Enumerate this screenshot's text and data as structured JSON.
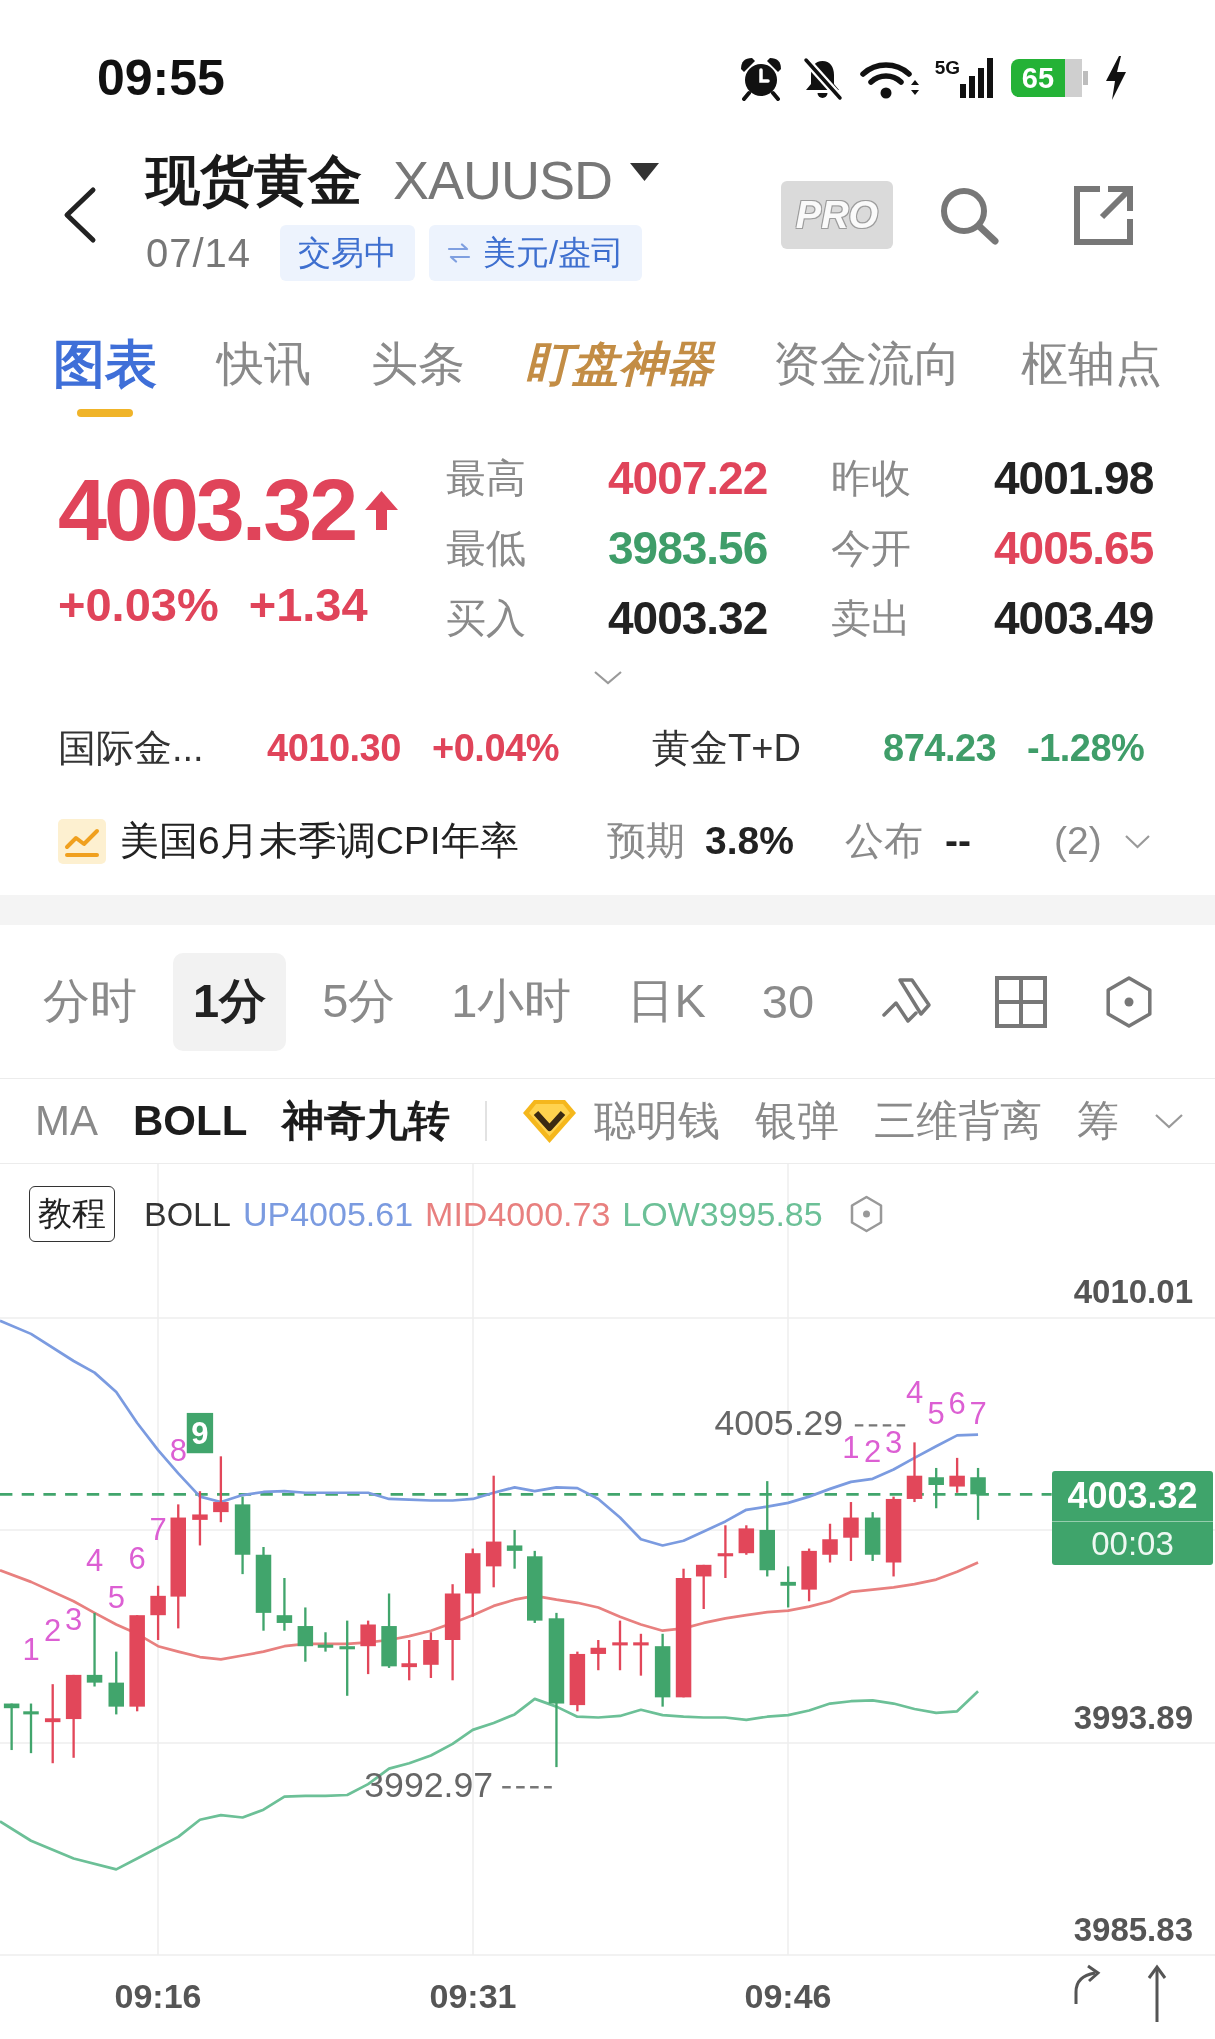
{
  "status_bar": {
    "time": "09:55",
    "network": "5G",
    "battery": "65"
  },
  "header": {
    "title": "现货黄金",
    "symbol": "XAUUSD",
    "date": "07/14",
    "badges": [
      {
        "kind": "status",
        "label": "交易中"
      },
      {
        "kind": "unit",
        "label": "美元/盎司"
      }
    ],
    "pro": "PRO"
  },
  "tabs": [
    {
      "label": "图表",
      "kind": "plain",
      "selected": true
    },
    {
      "label": "快讯",
      "kind": "plain",
      "selected": false
    },
    {
      "label": "头条",
      "kind": "plain",
      "selected": false
    },
    {
      "label": "盯盘神器",
      "kind": "featured",
      "selected": false
    },
    {
      "label": "资金流向",
      "kind": "plain",
      "selected": false
    },
    {
      "label": "枢轴点",
      "kind": "plain",
      "selected": false
    }
  ],
  "quote": {
    "price": "4003.32",
    "color": "#e0445a",
    "rising": true,
    "change_percent": "+0.03%",
    "change": "+1.34",
    "stats": [
      {
        "label": "最高",
        "value": "4007.22",
        "color": "#e0445a"
      },
      {
        "label": "昨收",
        "value": "4001.98",
        "color": "#222222"
      },
      {
        "label": "最低",
        "value": "3983.56",
        "color": "#3f9d69"
      },
      {
        "label": "今开",
        "value": "4005.65",
        "color": "#e0445a"
      },
      {
        "label": "买入",
        "value": "4003.32",
        "color": "#222222"
      },
      {
        "label": "卖出",
        "value": "4003.49",
        "color": "#222222"
      }
    ]
  },
  "related": [
    {
      "name": "国际金...",
      "price": "4010.30",
      "change": "+0.04%",
      "color": "#e0445a"
    },
    {
      "name": "黄金T+D",
      "price": "874.23",
      "change": "-1.28%",
      "color": "#3f9d69"
    }
  ],
  "event": {
    "title": "美国6月未季调CPI年率",
    "forecast_label": "预期",
    "forecast": "3.8%",
    "actual_label": "公布",
    "actual": "--",
    "count": "(2)"
  },
  "periods": [
    {
      "label": "分时",
      "selected": false
    },
    {
      "label": "1分",
      "selected": true
    },
    {
      "label": "5分",
      "selected": false
    },
    {
      "label": "1小时",
      "selected": false
    },
    {
      "label": "日K",
      "selected": false
    },
    {
      "label": "30",
      "selected": false
    }
  ],
  "indicators": {
    "main": [
      {
        "label": "MA",
        "selected": false
      },
      {
        "label": "BOLL",
        "selected": true
      },
      {
        "label": "神奇九转",
        "selected": true
      }
    ],
    "features": [
      {
        "label": "聪明钱",
        "premium": true,
        "selected": false
      },
      {
        "label": "银弹",
        "premium": false,
        "selected": false
      },
      {
        "label": "三维背离",
        "premium": false,
        "selected": false
      },
      {
        "label": "筹",
        "premium": false,
        "selected": false
      }
    ]
  },
  "chart": {
    "tutorial": "教程",
    "indicator": "BOLL",
    "bands": [
      {
        "label": "UP4005.61",
        "color": "#7b9be0"
      },
      {
        "label": "MID4000.73",
        "color": "#e8807f"
      },
      {
        "label": "LOW3995.85",
        "color": "#6cc097"
      }
    ],
    "y_labels": [
      "4010.01",
      "3993.89",
      "3985.83"
    ],
    "x_labels": [
      "09:16",
      "09:31",
      "09:46"
    ],
    "high_marker": "4005.29",
    "low_marker": "3992.97",
    "current_price": "4003.32",
    "countdown": "00:03",
    "sequence_marks": [
      {
        "text": "1",
        "kind": "count"
      },
      {
        "text": "2",
        "kind": "count"
      },
      {
        "text": "3",
        "kind": "count"
      },
      {
        "text": "4",
        "kind": "count"
      },
      {
        "text": "5",
        "kind": "count"
      },
      {
        "text": "6",
        "kind": "count"
      },
      {
        "text": "7",
        "kind": "count"
      },
      {
        "text": "8",
        "kind": "count"
      },
      {
        "text": "9",
        "kind": "signal"
      },
      {
        "text": "1",
        "kind": "count"
      },
      {
        "text": "2",
        "kind": "count"
      },
      {
        "text": "3",
        "kind": "count"
      },
      {
        "text": "4",
        "kind": "count"
      },
      {
        "text": "5",
        "kind": "count"
      },
      {
        "text": "6",
        "kind": "count"
      },
      {
        "text": "7",
        "kind": "count"
      }
    ]
  }
}
